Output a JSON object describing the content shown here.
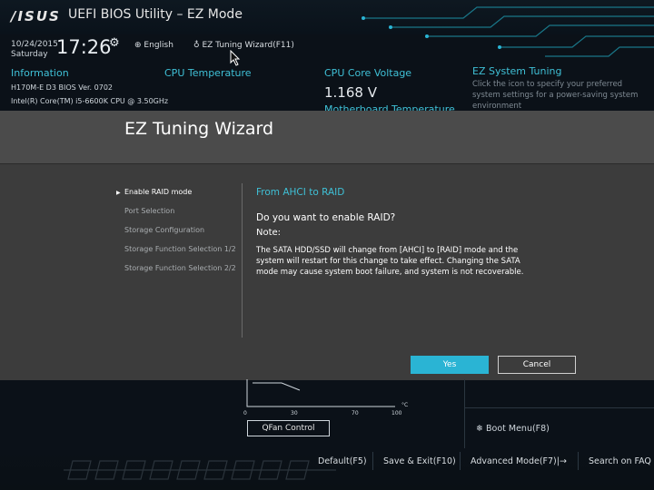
{
  "header": {
    "logo": "/ISUS",
    "title": "UEFI BIOS Utility – EZ Mode"
  },
  "infobar": {
    "date": "10/24/2015",
    "day": "Saturday",
    "time": "17:26",
    "language": "English",
    "wizard_link": "EZ Tuning Wizard(F11)"
  },
  "panes": {
    "information": {
      "heading": "Information",
      "board": "H170M-E D3   BIOS Ver. 0702",
      "cpu": "Intel(R) Core(TM) i5-6600K CPU @ 3.50GHz"
    },
    "cpu_temp": {
      "heading": "CPU Temperature"
    },
    "cpu_voltage": {
      "heading": "CPU Core Voltage",
      "value": "1.168 V",
      "sub_heading": "Motherboard Temperature"
    },
    "ez_tuning": {
      "heading": "EZ System Tuning",
      "text": "Click the icon to specify your preferred system settings for a power-saving system environment"
    }
  },
  "dialog": {
    "title": "EZ Tuning Wizard",
    "steps": [
      {
        "label": "Enable RAID mode"
      },
      {
        "label": "Port Selection"
      },
      {
        "label": "Storage Configuration"
      },
      {
        "label": "Storage Function Selection 1/2"
      },
      {
        "label": "Storage Function Selection 2/2"
      }
    ],
    "subheading": "From AHCI to RAID",
    "question": "Do you want to enable RAID?",
    "note_label": "Note:",
    "description": "The SATA HDD/SSD will change from [AHCI] to [RAID] mode and the system will restart for this change to take effect. Changing the SATA mode may cause system boot failure, and system is not recoverable.",
    "yes_label": "Yes",
    "cancel_label": "Cancel"
  },
  "fan": {
    "ticks": [
      "0",
      "30",
      "70",
      "100"
    ],
    "unit": "°C",
    "qfan_label": "QFan Control"
  },
  "boot_menu": {
    "label": "Boot Menu(F8)"
  },
  "footer": {
    "default": "Default(F5)",
    "save_exit": "Save & Exit(F10)",
    "advanced": "Advanced Mode(F7)|→",
    "search": "Search on FAQ"
  },
  "colors": {
    "accent": "#2ab4d4",
    "heading": "#3fc0d6",
    "dialog_head": "#4b4b4b",
    "dialog_body": "#3c3c3c"
  }
}
